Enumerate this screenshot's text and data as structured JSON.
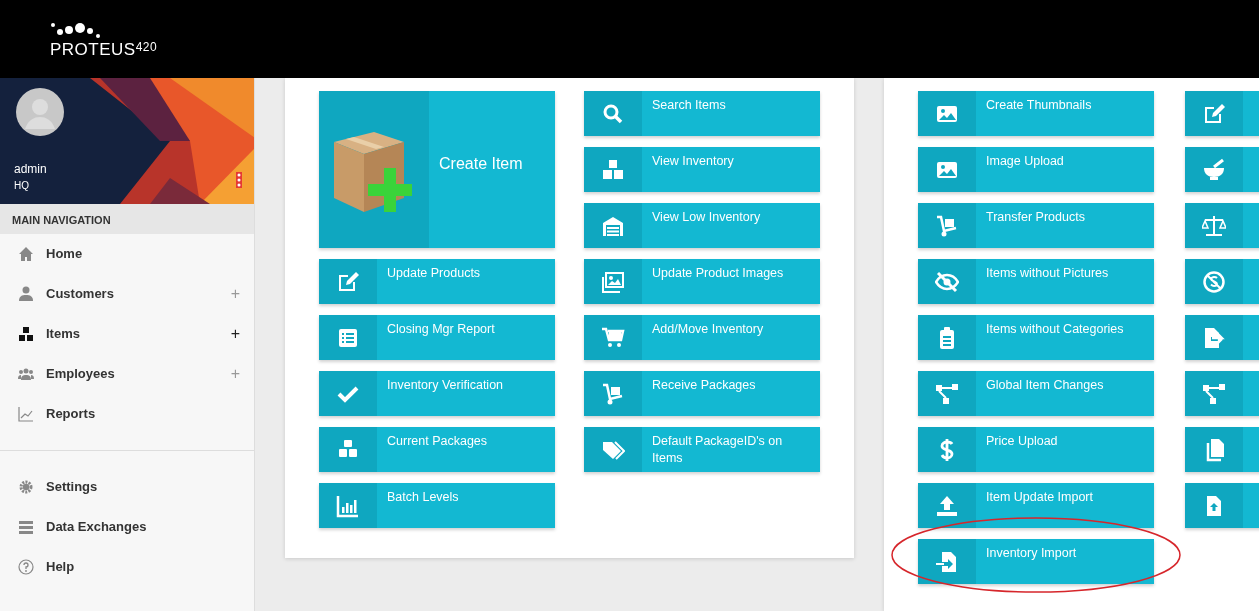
{
  "logo": {
    "name": "PROTEUS",
    "suffix": "420"
  },
  "user": {
    "name": "admin",
    "location": "HQ"
  },
  "sidebar": {
    "section_title": "MAIN NAVIGATION",
    "items": [
      {
        "label": "Home",
        "selected": false
      },
      {
        "label": "Customers",
        "expand_symbol": "+",
        "selected": false
      },
      {
        "label": "Items",
        "expand_symbol": "+",
        "selected": true
      },
      {
        "label": "Employees",
        "expand_symbol": "+",
        "selected": false
      },
      {
        "label": "Reports",
        "selected": false
      }
    ],
    "bottom_items": [
      {
        "label": "Settings"
      },
      {
        "label": "Data Exchanges"
      },
      {
        "label": "Help"
      }
    ]
  },
  "panels": [
    {
      "columns": [
        [
          {
            "kind": "large",
            "label": "Create Item"
          },
          {
            "kind": "small",
            "label": "Update Products"
          },
          {
            "kind": "small",
            "label": "Closing Mgr Report"
          },
          {
            "kind": "small",
            "label": "Inventory Verification"
          },
          {
            "kind": "small",
            "label": "Current Packages"
          },
          {
            "kind": "small",
            "label": "Batch Levels"
          }
        ],
        [
          {
            "kind": "small",
            "label": "Search Items"
          },
          {
            "kind": "small",
            "label": "View Inventory"
          },
          {
            "kind": "small",
            "label": "View Low Inventory"
          },
          {
            "kind": "small",
            "label": "Update Product Images"
          },
          {
            "kind": "small",
            "label": "Add/Move Inventory"
          },
          {
            "kind": "small",
            "label": "Receive Packages"
          },
          {
            "kind": "small",
            "label": "Default PackageID's on Items"
          }
        ]
      ]
    },
    {
      "columns": [
        [
          {
            "kind": "small",
            "label": "Create Thumbnails"
          },
          {
            "kind": "small",
            "label": "Image Upload"
          },
          {
            "kind": "small",
            "label": "Transfer Products"
          },
          {
            "kind": "small",
            "label": "Items without Pictures"
          },
          {
            "kind": "small",
            "label": "Items without Categories"
          },
          {
            "kind": "small",
            "label": "Global Item Changes"
          },
          {
            "kind": "small",
            "label": "Price Upload"
          },
          {
            "kind": "small",
            "label": "Item Update Import"
          },
          {
            "kind": "small",
            "label": "Inventory Import",
            "circled": true
          }
        ],
        [
          {
            "kind": "cut"
          },
          {
            "kind": "cut"
          },
          {
            "kind": "cut"
          },
          {
            "kind": "cut"
          },
          {
            "kind": "cut"
          },
          {
            "kind": "cut"
          },
          {
            "kind": "cut"
          },
          {
            "kind": "cut"
          }
        ]
      ]
    }
  ]
}
